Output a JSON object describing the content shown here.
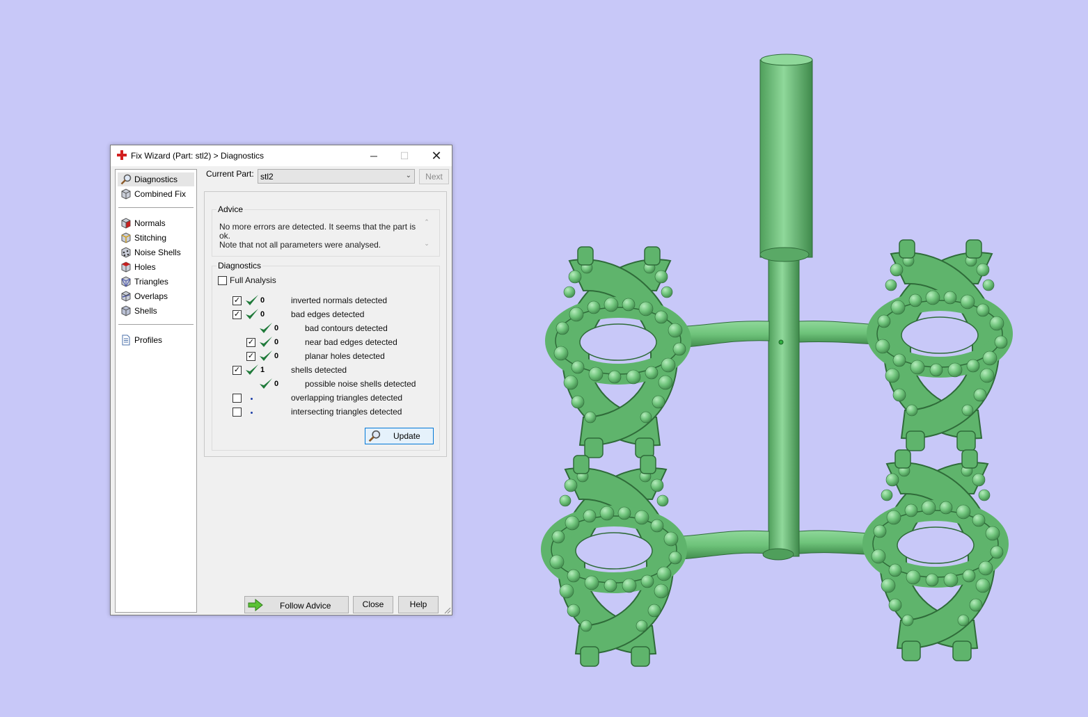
{
  "window": {
    "title": "Fix Wizard (Part: stl2) > Diagnostics",
    "minimize": "─",
    "maximize": "☐",
    "close": "✕"
  },
  "sidebar": {
    "items": [
      {
        "label": "Diagnostics",
        "icon": "magnifier-icon"
      },
      {
        "label": "Combined Fix",
        "icon": "cube-icon"
      },
      {
        "label": "Normals",
        "icon": "normals-cube-icon"
      },
      {
        "label": "Stitching",
        "icon": "stitching-cube-icon"
      },
      {
        "label": "Noise Shells",
        "icon": "noise-shells-icon"
      },
      {
        "label": "Holes",
        "icon": "holes-cube-icon"
      },
      {
        "label": "Triangles",
        "icon": "triangles-cube-icon"
      },
      {
        "label": "Overlaps",
        "icon": "overlaps-cube-icon"
      },
      {
        "label": "Shells",
        "icon": "shells-cube-icon"
      },
      {
        "label": "Profiles",
        "icon": "document-icon"
      }
    ]
  },
  "current_part": {
    "label": "Current Part:",
    "value": "stl2",
    "next_label": "Next"
  },
  "advice": {
    "title": "Advice",
    "line1": "No more errors are detected. It seems that the part is ok.",
    "line2": "Note that not all parameters were analysed."
  },
  "diagnostics": {
    "title": "Diagnostics",
    "full_analysis_label": "Full Analysis",
    "full_analysis_checked": false,
    "rows": [
      {
        "checked": true,
        "status": "ok",
        "value": "0",
        "label": "inverted normals detected"
      },
      {
        "checked": true,
        "status": "ok",
        "value": "0",
        "label": "bad edges detected"
      },
      {
        "checked": null,
        "status": "ok",
        "value": "0",
        "label": "bad contours detected"
      },
      {
        "checked": true,
        "status": "ok",
        "value": "0",
        "label": "near bad edges detected"
      },
      {
        "checked": true,
        "status": "ok",
        "value": "0",
        "label": "planar holes detected"
      },
      {
        "checked": true,
        "status": "ok",
        "value": "1",
        "label": "shells detected"
      },
      {
        "checked": null,
        "status": "ok",
        "value": "0",
        "label": "possible noise shells detected"
      },
      {
        "checked": false,
        "status": "not-analysed",
        "value": "",
        "label": "overlapping triangles detected"
      },
      {
        "checked": false,
        "status": "not-analysed",
        "value": "",
        "label": "intersecting triangles detected"
      }
    ],
    "update_label": "Update"
  },
  "footer": {
    "follow_advice_label": "Follow Advice",
    "close_label": "Close",
    "help_label": "Help"
  },
  "colors": {
    "background": "#c8c8f8",
    "model_green": "#6ec37a",
    "check_green": "#1f7a3a"
  }
}
